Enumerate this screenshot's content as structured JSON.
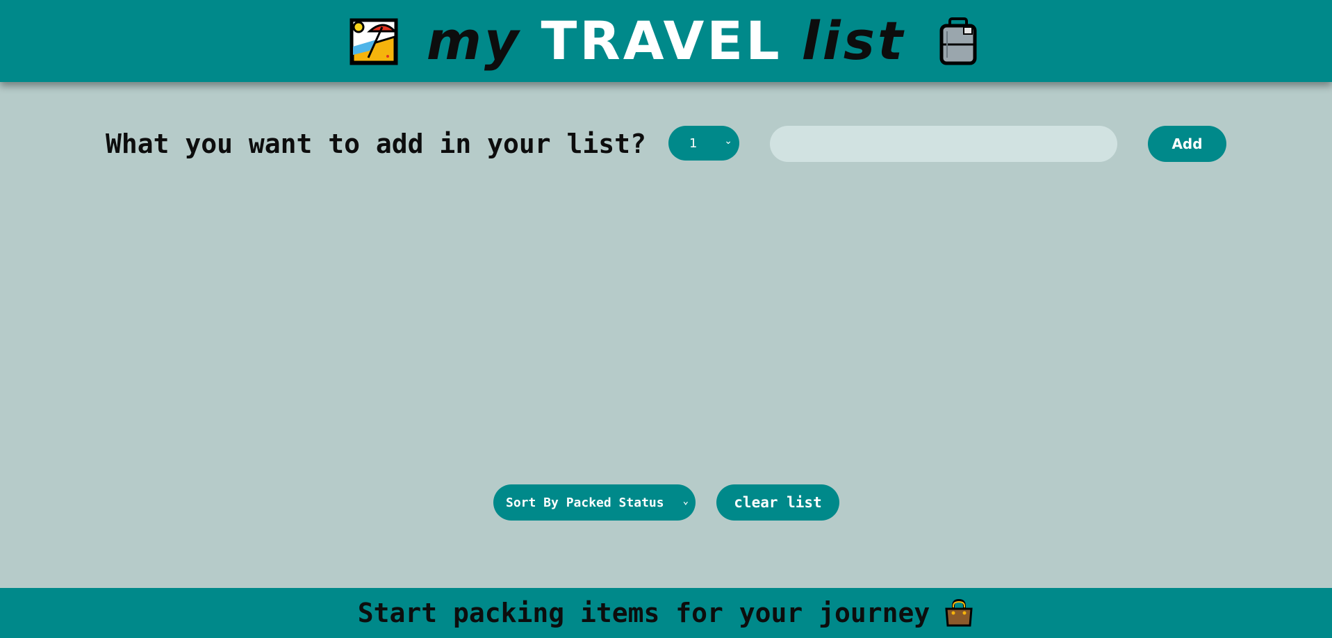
{
  "header": {
    "title_word_1": "my",
    "title_word_2": "TRAVEL",
    "title_word_3": "list",
    "left_icon": "beach-umbrella-icon",
    "right_icon": "luggage-icon"
  },
  "add_form": {
    "question": "What you want to add in your list?",
    "quantity_value": "1",
    "item_input_value": "",
    "item_input_placeholder": "",
    "add_label": "Add"
  },
  "actions": {
    "sort_value": "Sort By Packed Status",
    "clear_label": "clear list"
  },
  "footer": {
    "message": "Start packing items for your journey",
    "icon": "handbag-icon"
  },
  "colors": {
    "primary": "#00898a",
    "background": "#b6cbc9",
    "input_bg": "#d1e2e1"
  }
}
